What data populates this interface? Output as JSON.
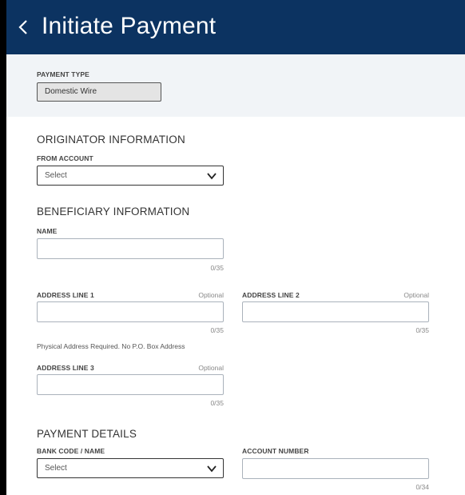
{
  "header": {
    "title": "Initiate Payment",
    "back_icon": "chevron-left-icon"
  },
  "payment_type": {
    "label": "PAYMENT TYPE",
    "value": "Domestic Wire"
  },
  "originator": {
    "section_title": "ORIGINATOR INFORMATION",
    "from_account": {
      "label": "FROM ACCOUNT",
      "value": "Select"
    }
  },
  "beneficiary": {
    "section_title": "BENEFICIARY INFORMATION",
    "name": {
      "label": "NAME",
      "counter": "0/35",
      "value": ""
    },
    "address1": {
      "label": "ADDRESS LINE 1",
      "optional": "Optional",
      "counter": "0/35",
      "value": ""
    },
    "address2": {
      "label": "ADDRESS LINE 2",
      "optional": "Optional",
      "counter": "0/35",
      "value": ""
    },
    "address_note": "Physical Address Required. No P.O. Box Address",
    "address3": {
      "label": "ADDRESS LINE 3",
      "optional": "Optional",
      "counter": "0/35",
      "value": ""
    }
  },
  "payment_details": {
    "section_title": "PAYMENT DETAILS",
    "bank_code": {
      "label": "BANK CODE / NAME",
      "value": "Select"
    },
    "account_number": {
      "label": "ACCOUNT NUMBER",
      "counter": "0/34",
      "value": ""
    }
  },
  "colors": {
    "header_bg": "#0c3361",
    "panel_bg": "#f1f4f7"
  }
}
